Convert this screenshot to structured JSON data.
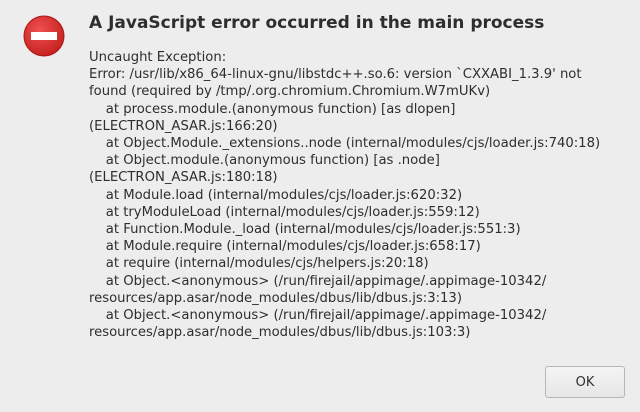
{
  "dialog": {
    "title": "A JavaScript error occurred in the main process",
    "icon": "error-stop-icon",
    "icon_color": "#d62a2a",
    "message_lines": [
      "Uncaught Exception:",
      "Error: /usr/lib/x86_64-linux-gnu/libstdc++.so.6: version `CXXABI_1.3.9' not",
      "found (required by /tmp/.org.chromium.Chromium.W7mUKv)",
      "    at process.module.(anonymous function) [as dlopen]",
      "(ELECTRON_ASAR.js:166:20)",
      "    at Object.Module._extensions..node (internal/modules/cjs/loader.js:740:18)",
      "    at Object.module.(anonymous function) [as .node]",
      "(ELECTRON_ASAR.js:180:18)",
      "    at Module.load (internal/modules/cjs/loader.js:620:32)",
      "    at tryModuleLoad (internal/modules/cjs/loader.js:559:12)",
      "    at Function.Module._load (internal/modules/cjs/loader.js:551:3)",
      "    at Module.require (internal/modules/cjs/loader.js:658:17)",
      "    at require (internal/modules/cjs/helpers.js:20:18)",
      "    at Object.<anonymous> (/run/firejail/appimage/.appimage-10342/",
      "resources/app.asar/node_modules/dbus/lib/dbus.js:3:13)",
      "    at Object.<anonymous> (/run/firejail/appimage/.appimage-10342/",
      "resources/app.asar/node_modules/dbus/lib/dbus.js:103:3)"
    ],
    "ok_label": "OK"
  }
}
